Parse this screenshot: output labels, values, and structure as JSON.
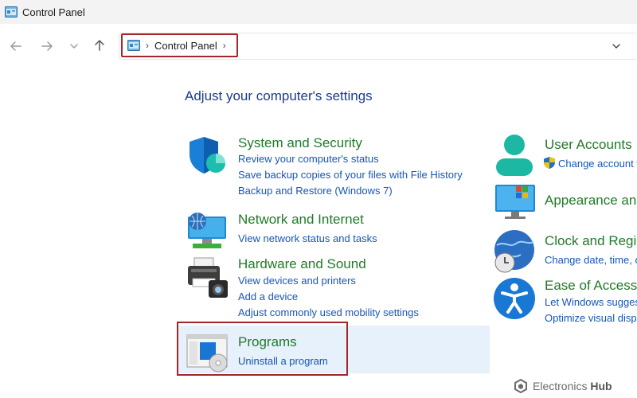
{
  "window": {
    "title": "Control Panel"
  },
  "address": {
    "crumb": "Control Panel",
    "separator": "›"
  },
  "main": {
    "heading": "Adjust your computer's settings"
  },
  "left_categories": [
    {
      "title": "System and Security",
      "links": [
        "Review your computer's status",
        "Save backup copies of your files with File History",
        "Backup and Restore (Windows 7)"
      ]
    },
    {
      "title": "Network and Internet",
      "links": [
        "View network status and tasks"
      ]
    },
    {
      "title": "Hardware and Sound",
      "links": [
        "View devices and printers",
        "Add a device",
        "Adjust commonly used mobility settings"
      ]
    },
    {
      "title": "Programs",
      "links": [
        "Uninstall a program"
      ]
    }
  ],
  "right_categories": [
    {
      "title": "User Accounts",
      "links": [
        "Change account t"
      ]
    },
    {
      "title": "Appearance an",
      "links": []
    },
    {
      "title": "Clock and Regi",
      "links": [
        "Change date, time, c"
      ]
    },
    {
      "title": "Ease of Access",
      "links": [
        "Let Windows sugges",
        "Optimize visual disp"
      ]
    }
  ],
  "watermark": {
    "text": "Electronics",
    "bold": "Hub"
  },
  "colors": {
    "title_green": "#217a28",
    "link_blue": "#1656b8",
    "highlight_red": "#a4262c",
    "selected_bg": "#e6f1fb"
  }
}
